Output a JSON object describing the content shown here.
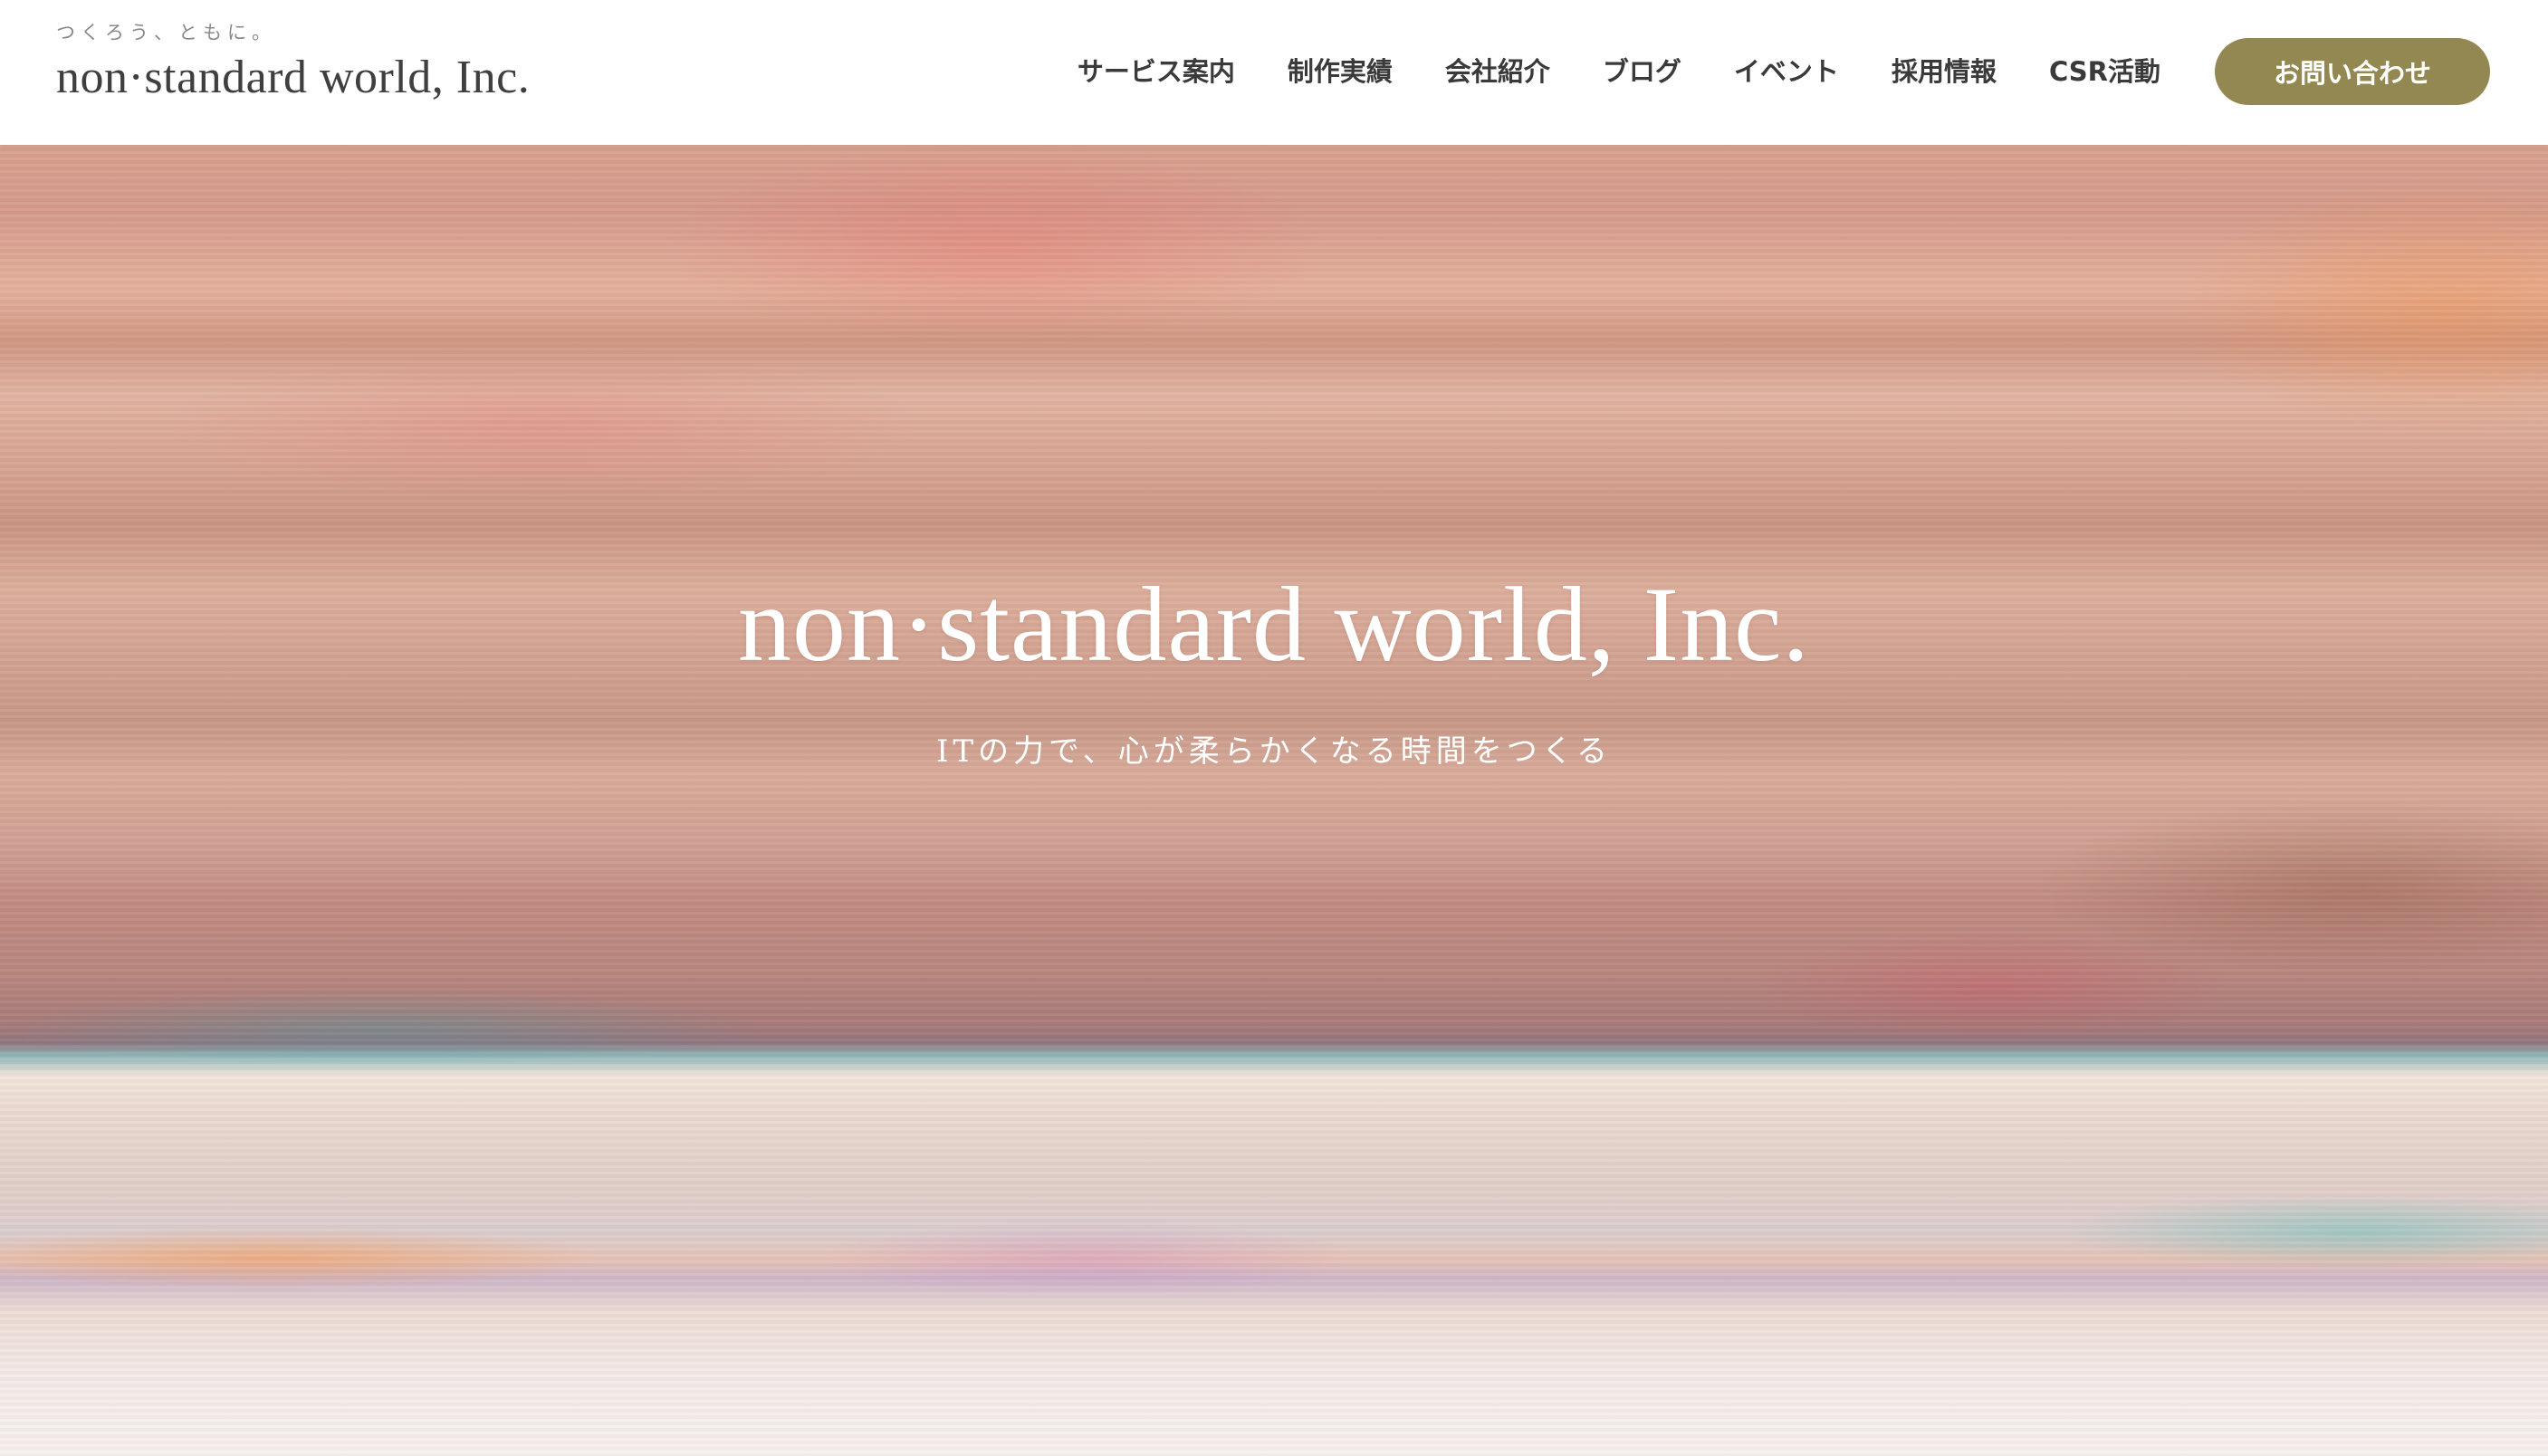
{
  "header": {
    "tagline": "つくろう、ともに。",
    "logo_text": "non·standard world, Inc.",
    "nav": [
      {
        "label": "サービス案内"
      },
      {
        "label": "制作実績"
      },
      {
        "label": "会社紹介"
      },
      {
        "label": "ブログ"
      },
      {
        "label": "イベント"
      },
      {
        "label": "採用情報"
      },
      {
        "label": "CSR活動"
      }
    ],
    "contact_label": "お問い合わせ"
  },
  "hero": {
    "title": "non·standard world, Inc.",
    "tagline": "ITの力で、心が柔らかくなる時間をつくる"
  },
  "colors": {
    "accent": "#948852",
    "header_bg": "#ffffff",
    "text": "#3a3a3a"
  }
}
